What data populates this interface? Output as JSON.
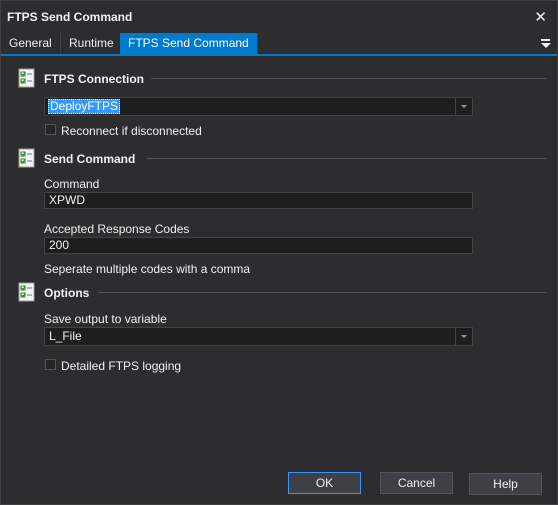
{
  "window": {
    "title": "FTPS Send Command"
  },
  "tabs": [
    {
      "label": "General"
    },
    {
      "label": "Runtime"
    },
    {
      "label": "FTPS Send Command"
    }
  ],
  "sections": {
    "connection": {
      "title": "FTPS Connection",
      "dropdown_value": "DeployFTPS",
      "reconnect_label": "Reconnect if disconnected",
      "reconnect_checked": false
    },
    "send_command": {
      "title": "Send Command",
      "command_label": "Command",
      "command_value": "XPWD",
      "codes_label": "Accepted Response Codes",
      "codes_value": "200",
      "codes_hint": "Seperate multiple codes with a comma"
    },
    "options": {
      "title": "Options",
      "save_label": "Save output to variable",
      "save_value": "L_File",
      "logging_label": "Detailed FTPS logging",
      "logging_checked": false
    }
  },
  "buttons": {
    "ok": "OK",
    "cancel": "Cancel",
    "help": "Help"
  },
  "colors": {
    "background": "#2d2d30",
    "accent": "#007acc",
    "selection": "#3399ff",
    "field": "#1e1e1e"
  }
}
